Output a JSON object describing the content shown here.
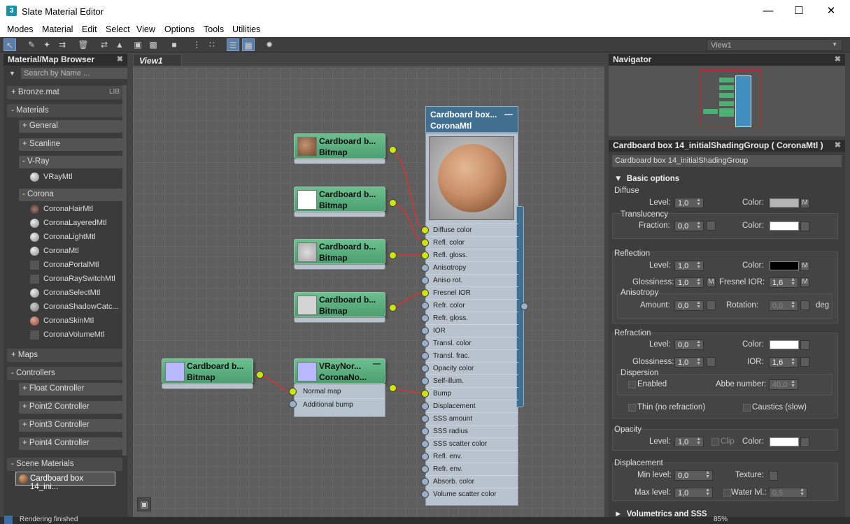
{
  "window": {
    "app_icon": "3",
    "title": "Slate Material Editor"
  },
  "menu": [
    "Modes",
    "Material",
    "Edit",
    "Select",
    "View",
    "Options",
    "Tools",
    "Utilities"
  ],
  "view_selector": "View1",
  "browser": {
    "title": "Material/Map Browser",
    "search_placeholder": "Search by Name ...",
    "bronze": "+ Bronze.mat",
    "lib": "LIB",
    "materials": "- Materials",
    "general": "+ General",
    "scanline": "+ Scanline",
    "vray": "- V-Ray",
    "vray_items": [
      "VRayMtl"
    ],
    "corona": "- Corona",
    "corona_items": [
      "CoronaHairMtl",
      "CoronaLayeredMtl",
      "CoronaLightMtl",
      "CoronaMtl",
      "CoronaPortalMtl",
      "CoronaRaySwitchMtl",
      "CoronaSelectMtl",
      "CoronaShadowCatc...",
      "CoronaSkinMtl",
      "CoronaVolumeMtl"
    ],
    "maps": "+ Maps",
    "controllers": "- Controllers",
    "controller_items": [
      "+ Float Controller",
      "+ Point2 Controller",
      "+ Point3 Controller",
      "+ Point4 Controller"
    ],
    "scene_materials": "- Scene Materials",
    "scene_item": "Cardboard box 14_ini..."
  },
  "view_tab": "View1",
  "nodes": {
    "bitmap_title": "Cardboard b...",
    "bitmap_type": "Bitmap",
    "vray_title": "VRayNor...",
    "vray_type": "CoronaNo...",
    "vray_slots": [
      "Normal map",
      "Additional bump"
    ],
    "main_title": "Cardboard box...",
    "main_type": "CoronaMtl",
    "main_slots": [
      "Diffuse color",
      "Refl. color",
      "Refl. gloss.",
      "Anisotropy",
      "Aniso rot.",
      "Fresnel IOR",
      "Refr. color",
      "Refr. gloss.",
      "IOR",
      "Transl. color",
      "Transl. frac.",
      "Opacity color",
      "Self-illum.",
      "Bump",
      "Displacement",
      "SSS amount",
      "SSS radius",
      "SSS scatter color",
      "Refl. env.",
      "Refr. env.",
      "Absorb. color",
      "Volume scatter color"
    ]
  },
  "navigator": {
    "title": "Navigator"
  },
  "props": {
    "title": "Cardboard box 14_initialShadingGroup  ( CoronaMtl )",
    "name": "Cardboard box 14_initialShadingGroup",
    "basic": "Basic options",
    "diffuse": "Diffuse",
    "level": "Level:",
    "color": "Color:",
    "m": "M",
    "translucency": "Translucency",
    "fraction": "Fraction:",
    "reflection": "Reflection",
    "glossiness": "Glossiness:",
    "fresnel_ior": "Fresnel IOR:",
    "anisotropy": "Anisotropy",
    "amount": "Amount:",
    "rotation": "Rotation:",
    "deg": "deg",
    "refraction": "Refraction",
    "ior": "IOR:",
    "dispersion": "Dispersion",
    "enabled": "Enabled",
    "abbe": "Abbe number:",
    "thin": "Thin (no refraction)",
    "caustics": "Caustics (slow)",
    "opacity": "Opacity",
    "clip": "Clip",
    "displacement": "Displacement",
    "min_level": "Min level:",
    "max_level": "Max level:",
    "texture": "Texture:",
    "water": "Water lvl.:",
    "volumetrics": "Volumetrics and SSS",
    "values": {
      "v1_0": "1,0",
      "v0_0": "0,0",
      "v1_6": "1,6",
      "v40": "40,0",
      "v0_5": "0,5"
    }
  },
  "colors": {
    "diffuse": "#b4b4b4",
    "translucency": "#ffffff",
    "reflection": "#000000",
    "refraction": "#ffffff",
    "opacity": "#ffffff"
  },
  "status": {
    "text": "Rendering finished",
    "zoom": "85%"
  }
}
